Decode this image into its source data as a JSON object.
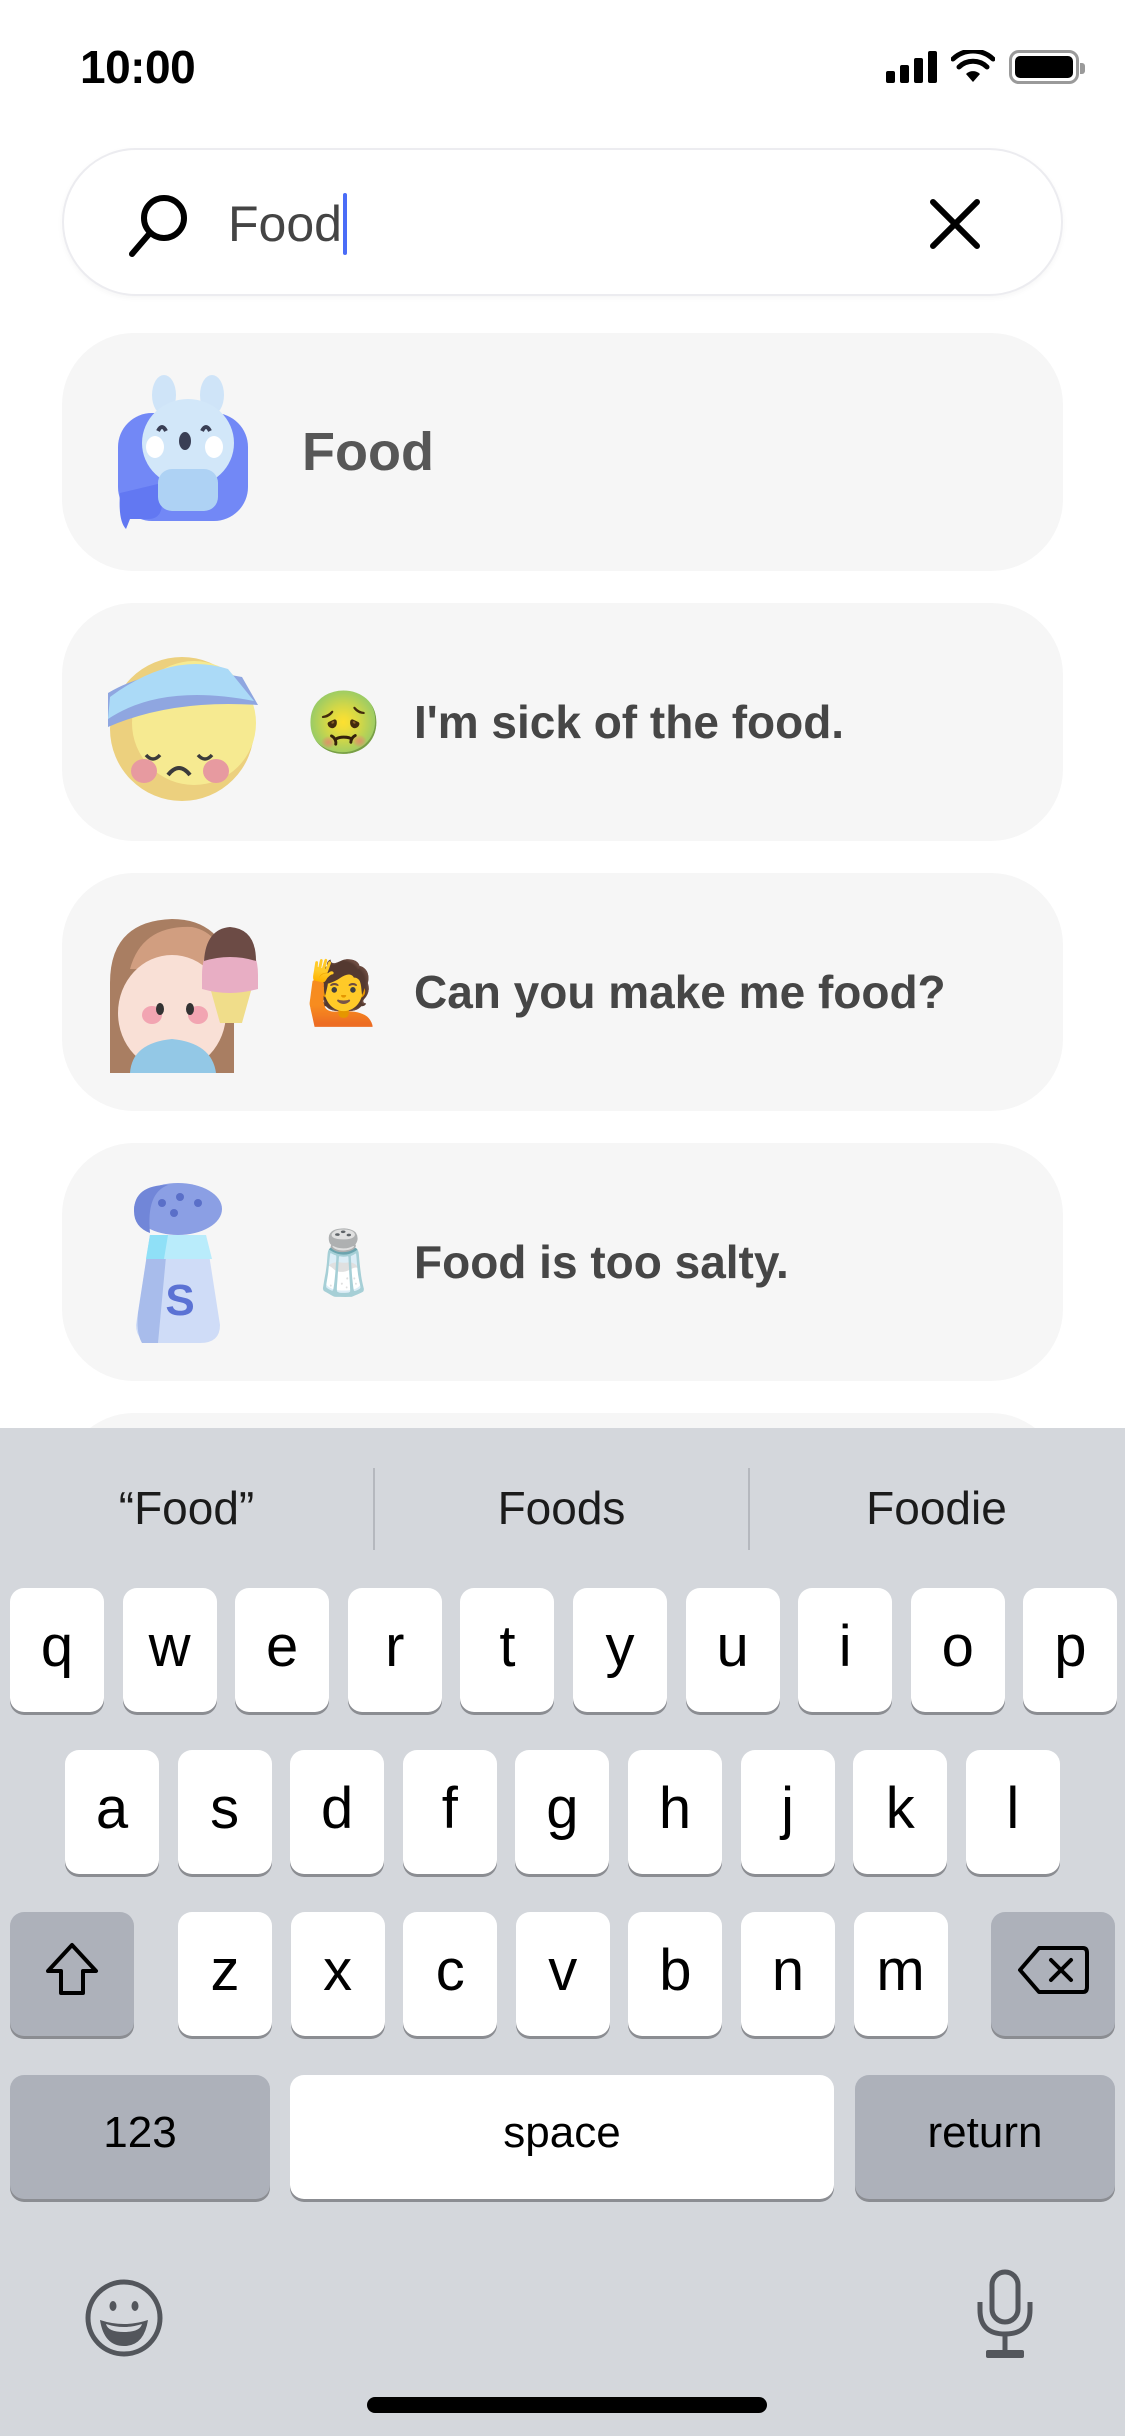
{
  "status_bar": {
    "time": "10:00",
    "icons": [
      "cellular-signal-icon",
      "wifi-icon",
      "battery-icon"
    ]
  },
  "search": {
    "value": "Food",
    "icon": "search-icon",
    "clear_icon": "close-icon",
    "caret_color": "#4a6cf7"
  },
  "results": [
    {
      "label": "Food",
      "art": "bunny-sticker",
      "emoji": null
    },
    {
      "label": "I'm sick of the food.",
      "art": "bandaged-sad-face-sticker",
      "emoji": "🤢"
    },
    {
      "label": "Can you make me food?",
      "art": "girl-with-ice-cream-sticker",
      "emoji": "🙋"
    },
    {
      "label": "Food is too salty.",
      "art": "salt-shaker-sticker",
      "emoji": "🧂"
    },
    {
      "label": "",
      "art": "",
      "emoji": null
    }
  ],
  "keyboard": {
    "suggestions": [
      "“Food”",
      "Foods",
      "Foodie"
    ],
    "row1": [
      "q",
      "w",
      "e",
      "r",
      "t",
      "y",
      "u",
      "i",
      "o",
      "p"
    ],
    "row2": [
      "a",
      "s",
      "d",
      "f",
      "g",
      "h",
      "j",
      "k",
      "l"
    ],
    "row3": [
      "z",
      "x",
      "c",
      "v",
      "b",
      "n",
      "m"
    ],
    "numbers_label": "123",
    "space_label": "space",
    "return_label": "return",
    "colors": {
      "background": "#d4d7dc",
      "key": "#ffffff",
      "function_key": "#adb1ba"
    }
  }
}
